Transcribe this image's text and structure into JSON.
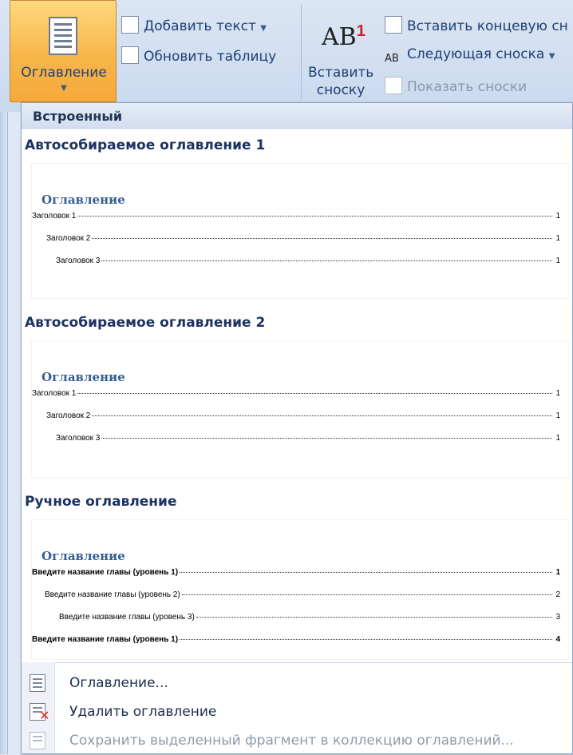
{
  "ribbon": {
    "toc_button_label": "Оглавление",
    "add_text_label": "Добавить текст",
    "update_table_label": "Обновить таблицу",
    "insert_endnote_label": "Вставить концевую сн",
    "insert_footnote_label": "Вставить сноску",
    "next_footnote_label": "Следующая сноска",
    "show_notes_label": "Показать сноски",
    "ab_text": "AB",
    "ab_sup": "1"
  },
  "menu": {
    "header": "Встроенный",
    "sections": [
      {
        "title": "Автособираемое оглавление 1",
        "heading": "Оглавление",
        "rows": [
          {
            "text": "Заголовок 1",
            "page": "1"
          },
          {
            "text": "Заголовок 2",
            "page": "1"
          },
          {
            "text": "Заголовок 3",
            "page": "1"
          }
        ]
      },
      {
        "title": "Автособираемое оглавление 2",
        "heading": "Оглавление",
        "rows": [
          {
            "text": "Заголовок 1",
            "page": "1"
          },
          {
            "text": "Заголовок 2",
            "page": "1"
          },
          {
            "text": "Заголовок 3",
            "page": "1"
          }
        ]
      },
      {
        "title": "Ручное оглавление",
        "heading": "Оглавление",
        "rows": [
          {
            "text": "Введите название главы (уровень 1)",
            "page": "1"
          },
          {
            "text": "Введите название главы (уровень 2)",
            "page": "2"
          },
          {
            "text": "Введите название главы (уровень 3)",
            "page": "3"
          },
          {
            "text": "Введите название главы (уровень 1)",
            "page": "4"
          }
        ]
      }
    ],
    "commands": [
      {
        "label": "Оглавление...",
        "enabled": true
      },
      {
        "label": "Удалить оглавление",
        "enabled": true
      },
      {
        "label": "Сохранить выделенный фрагмент в коллекцию оглавлений...",
        "enabled": false
      }
    ]
  },
  "colors": {
    "accent_orange": "#f7b64b",
    "heading_blue": "#365f91",
    "title_navy": "#1c3260",
    "delete_red": "#d42a1e"
  },
  "icons": [
    "toc-document-icon",
    "add-text-icon",
    "update-table-icon",
    "insert-endnote-icon",
    "next-footnote-icon",
    "show-notes-icon",
    "toc-dialog-icon",
    "delete-toc-icon",
    "save-selection-icon"
  ]
}
